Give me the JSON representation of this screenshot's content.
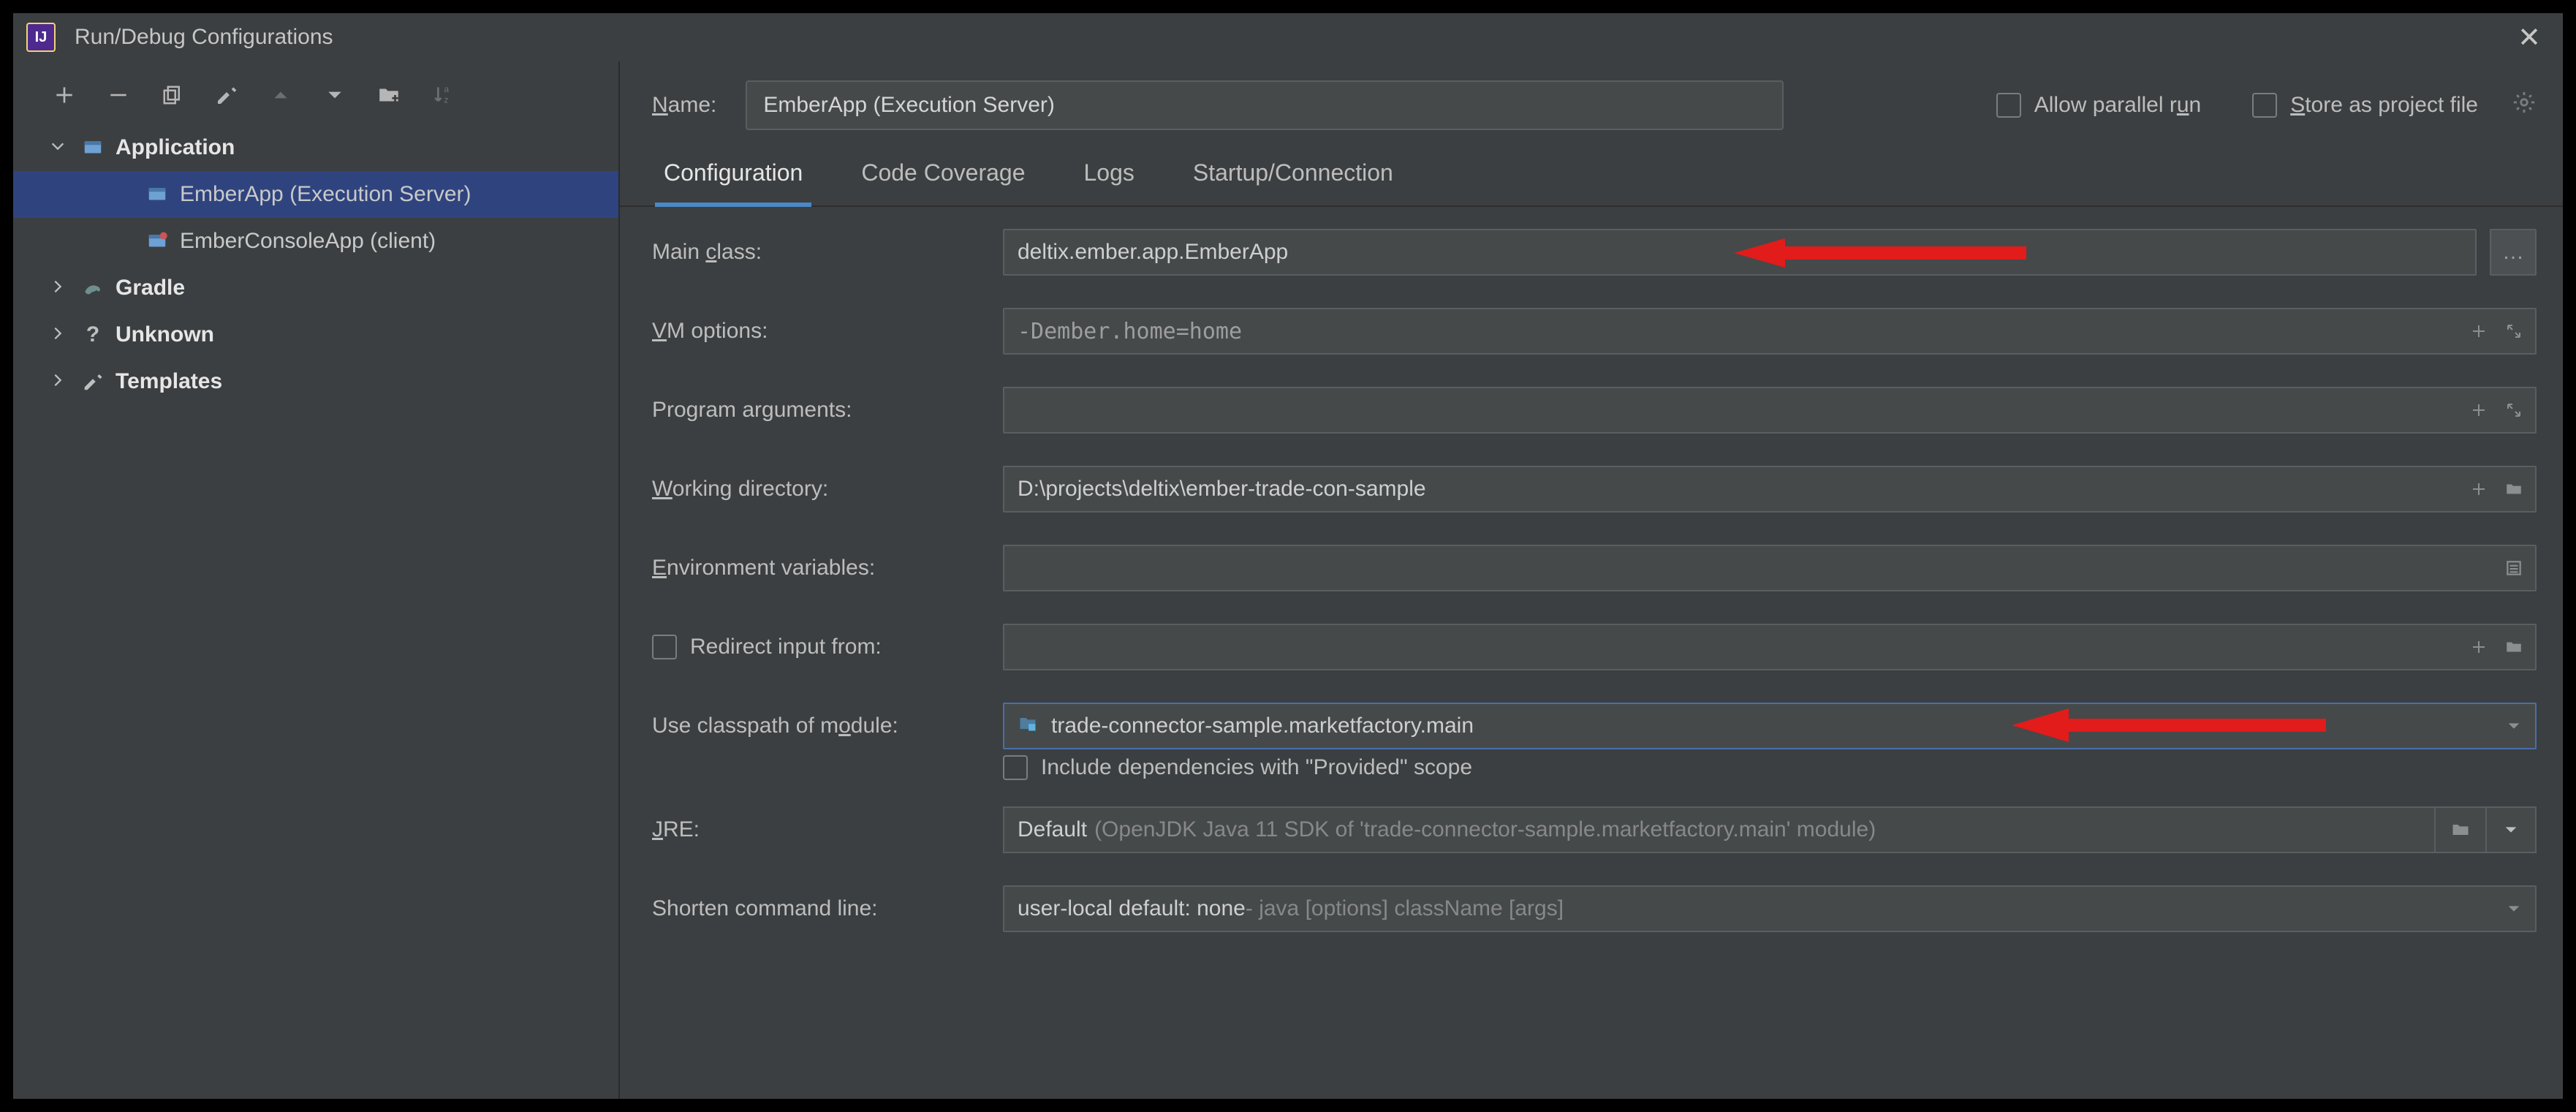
{
  "title": "Run/Debug Configurations",
  "app_icon_text": "IJ",
  "tree": {
    "nodes": [
      {
        "label": "Application",
        "bold": true,
        "expanded": true,
        "icon": "app"
      },
      {
        "label": "EmberApp (Execution Server)",
        "child": true,
        "selected": true,
        "icon": "app"
      },
      {
        "label": "EmberConsoleApp (client)",
        "child": true,
        "icon": "app-edited"
      },
      {
        "label": "Gradle",
        "bold": true,
        "icon": "gradle"
      },
      {
        "label": "Unknown",
        "bold": true,
        "icon": "unknown"
      },
      {
        "label": "Templates",
        "bold": true,
        "icon": "templates"
      }
    ]
  },
  "header": {
    "name_label_pre": "N",
    "name_label_post": "ame:",
    "name_value": "EmberApp (Execution Server)",
    "allow_parallel_pre": "Allow parallel r",
    "allow_parallel_u": "u",
    "allow_parallel_post": "n",
    "store_pre": "",
    "store_u": "S",
    "store_post": "tore as project file"
  },
  "tabs": [
    "Configuration",
    "Code Coverage",
    "Logs",
    "Startup/Connection"
  ],
  "active_tab": 0,
  "form": {
    "main_class": {
      "label_pre": "Main ",
      "label_u": "c",
      "label_post": "lass:",
      "value": "deltix.ember.app.EmberApp"
    },
    "vm_options": {
      "label_u": "V",
      "label_post": "M options:",
      "value": "-Dember.home=home"
    },
    "program_args": {
      "label_pre": "Program ar",
      "label_u": "g",
      "label_post": "uments:",
      "value": ""
    },
    "working_dir": {
      "label_u": "W",
      "label_post": "orking directory:",
      "value": "D:\\projects\\deltix\\ember-trade-con-sample"
    },
    "env_vars": {
      "label_u": "E",
      "label_post": "nvironment variables:",
      "value": ""
    },
    "redirect_input": {
      "label": "Redirect input from:"
    },
    "classpath_module": {
      "label_pre": "Use classpath of m",
      "label_u": "o",
      "label_post": "dule:",
      "value": "trade-connector-sample.marketfactory.main"
    },
    "include_provided": "Include dependencies with \"Provided\" scope",
    "jre": {
      "label_u": "J",
      "label_post": "RE:",
      "default": "Default",
      "detail": "(OpenJDK Java 11   SDK of 'trade‑connector‑sample.marketfactory.main' module)"
    },
    "shorten": {
      "label": "Shorten command line:",
      "value": "user-local default: none",
      "detail": " - java [options] className [args]"
    }
  }
}
